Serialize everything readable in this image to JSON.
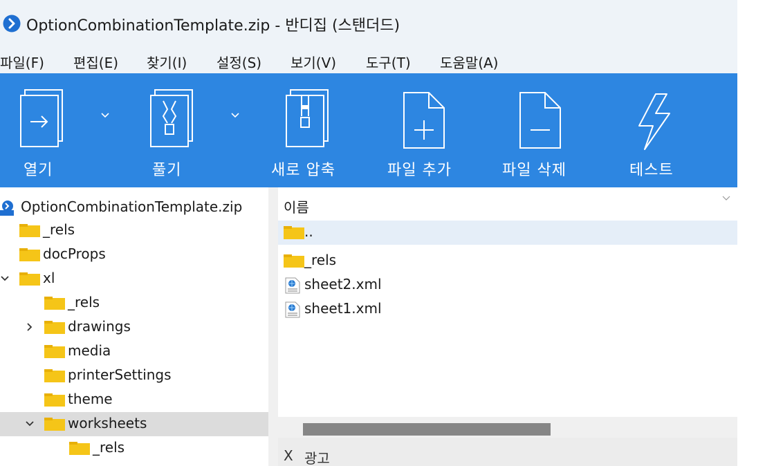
{
  "window": {
    "title": "OptionCombinationTemplate.zip - 반디집 (스탠더드)"
  },
  "menu": [
    "파일(F)",
    "편집(E)",
    "찾기(I)",
    "설정(S)",
    "보기(V)",
    "도구(T)",
    "도움말(A)"
  ],
  "toolbar": {
    "open": "열기",
    "extract": "풀기",
    "new_archive": "새로 압축",
    "add_file": "파일 추가",
    "delete_file": "파일 삭제",
    "test": "테스트"
  },
  "tree": {
    "root": "OptionCombinationTemplate.zip",
    "items": [
      "_rels",
      "docProps",
      "xl",
      "_rels",
      "drawings",
      "media",
      "printerSettings",
      "theme",
      "worksheets",
      "_rels"
    ]
  },
  "filelist": {
    "header": "이름",
    "rows": [
      "..",
      "_rels",
      "sheet2.xml",
      "sheet1.xml"
    ]
  },
  "bottom": {
    "close": "X",
    "text": "광고"
  },
  "colors": {
    "toolbar": "#2d86e1",
    "titlebar": "#eef3f8",
    "folder": "#f5c518",
    "selected": "#dcdcdc",
    "hover": "#e5eef8"
  }
}
